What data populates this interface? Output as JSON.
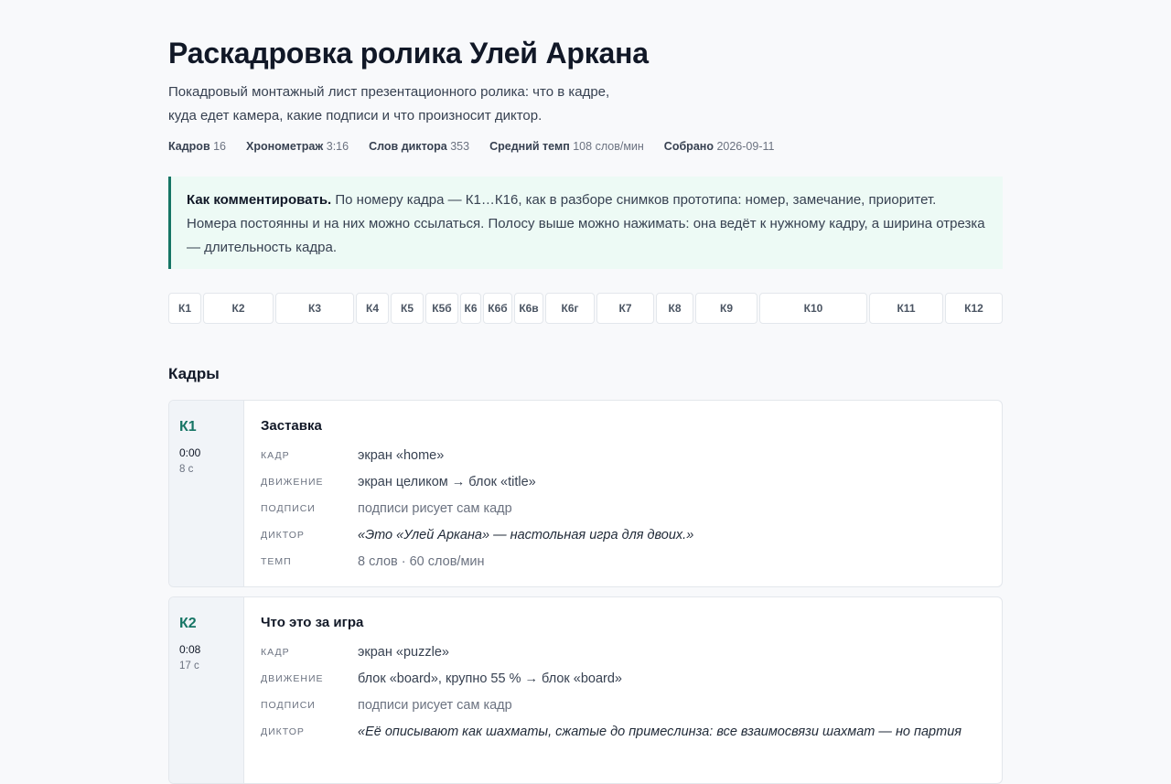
{
  "header": {
    "title": "Раскадровка ролика Улей Аркана",
    "subtitle_line1": "Покадровый монтажный лист презентационного ролика: что в кадре,",
    "subtitle_line2": "куда едет камера, какие подписи и что произносит диктор."
  },
  "meta": [
    {
      "label": "Кадров",
      "value": "16"
    },
    {
      "label": "Хронометраж",
      "value": "3:16"
    },
    {
      "label": "Слов диктора",
      "value": "353"
    },
    {
      "label": "Средний темп",
      "value": "108 слов/мин"
    },
    {
      "label": "Собрано",
      "value": "2026-09-11"
    }
  ],
  "note": {
    "lead": "Как комментировать.",
    "text": "По номеру кадра — К1…К16, как в разборе снимков прототипа: номер, замечание, приоритет. Номера постоянны и на них можно ссылаться. Полосу выше можно нажимать: она ведёт к нужному кадру, а ширина отрезка — длительность кадра."
  },
  "strip": [
    {
      "label": "К1",
      "seconds": 8
    },
    {
      "label": "К2",
      "seconds": 17
    },
    {
      "label": "К3",
      "seconds": 19
    },
    {
      "label": "К4",
      "seconds": 8
    },
    {
      "label": "К5",
      "seconds": 8
    },
    {
      "label": "К5б",
      "seconds": 8
    },
    {
      "label": "К6",
      "seconds": 5
    },
    {
      "label": "К6б",
      "seconds": 7
    },
    {
      "label": "К6в",
      "seconds": 7
    },
    {
      "label": "К6г",
      "seconds": 12
    },
    {
      "label": "К7",
      "seconds": 14
    },
    {
      "label": "К8",
      "seconds": 9
    },
    {
      "label": "К9",
      "seconds": 15
    },
    {
      "label": "К10",
      "seconds": 26
    },
    {
      "label": "К11",
      "seconds": 18
    },
    {
      "label": "К12",
      "seconds": 14
    }
  ],
  "section_title": "Кадры",
  "labels": {
    "frame": "кадр",
    "motion": "движение",
    "captions": "подписи",
    "voice": "диктор",
    "pace": "темп"
  },
  "frames": [
    {
      "id": "К1",
      "time": "0:00",
      "duration": "8 с",
      "title": "Заставка",
      "frame": "экран «home»",
      "motion": "экран целиком → блок «title»",
      "captions": "подписи рисует сам кадр",
      "voice": "«Это «Улей Аркана» — настольная игра для двоих.»",
      "pace": "8 слов · 60 слов/мин"
    },
    {
      "id": "К2",
      "time": "0:08",
      "duration": "17 с",
      "title": "Что это за игра",
      "frame": "экран «puzzle»",
      "motion": "блок «board», крупно 55 % → блок «board»",
      "captions": "подписи рисует сам кадр",
      "voice": "«Её описывают как шахматы, сжатые до примеслинза: все взаимосвязи шахмат — но партия",
      "pace": ""
    }
  ]
}
